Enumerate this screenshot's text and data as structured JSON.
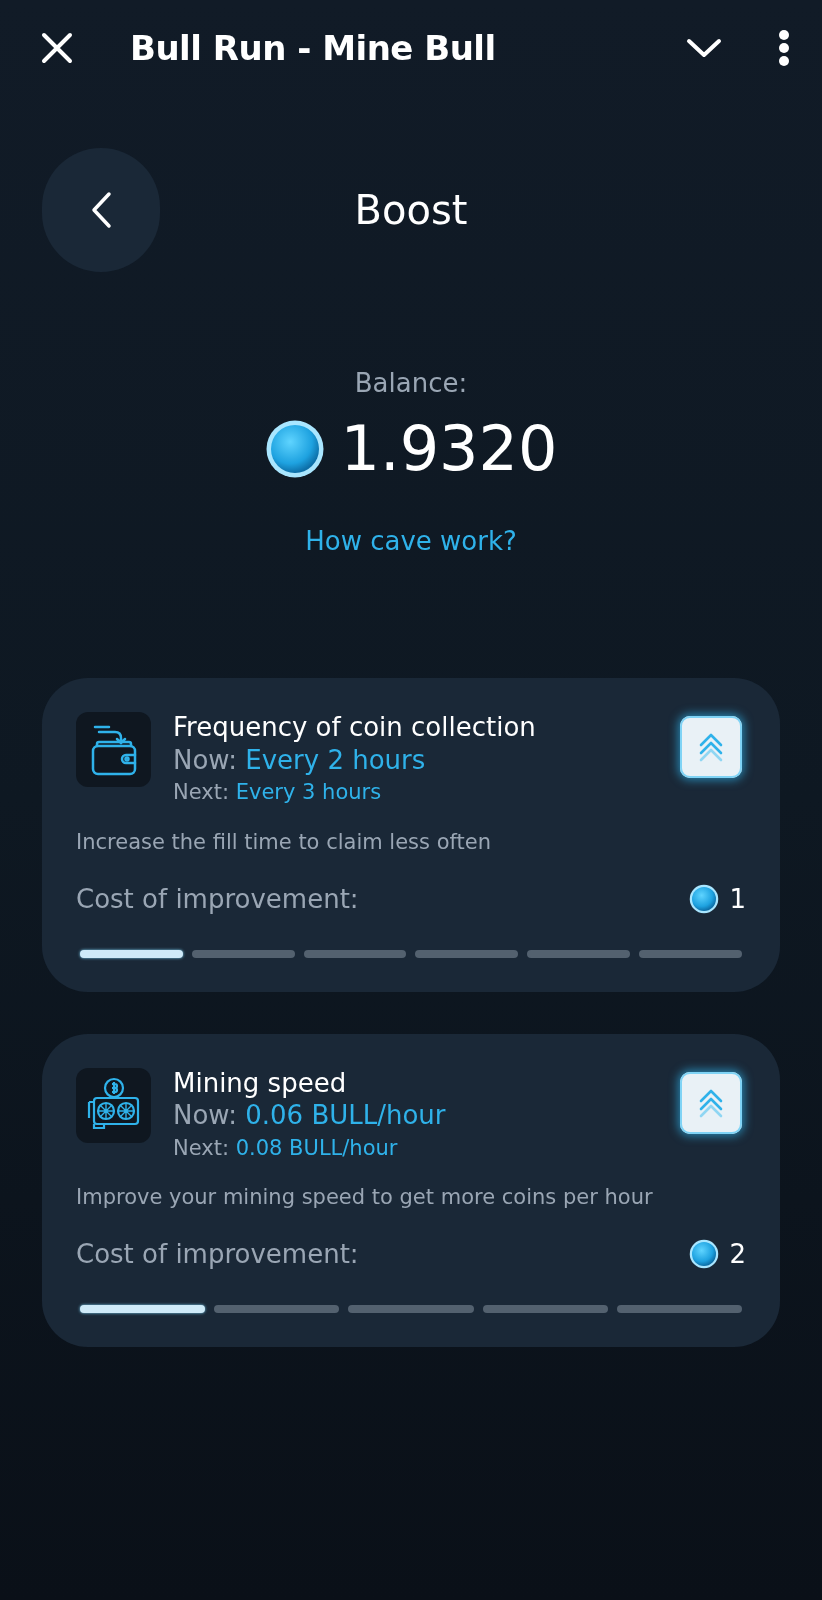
{
  "top_bar": {
    "title": "Bull Run - Mine Bull"
  },
  "header": {
    "title": "Boost"
  },
  "balance": {
    "label": "Balance:",
    "amount": "1.9320",
    "link": "How cave work?"
  },
  "boosts": [
    {
      "kind": "wallet",
      "title": "Frequency of coin collection",
      "now_label": "Now:",
      "now_value": "Every 2 hours",
      "next_label": "Next:",
      "next_value": "Every 3 hours",
      "description": "Increase the fill time to claim less often",
      "cost_label": "Cost of improvement:",
      "cost": "1",
      "segments": [
        {
          "filled": true
        },
        {
          "filled": false
        },
        {
          "filled": false
        },
        {
          "filled": false
        },
        {
          "filled": false
        },
        {
          "filled": false
        }
      ]
    },
    {
      "kind": "gpu",
      "title": "Mining speed",
      "now_label": "Now:",
      "now_value": "0.06 BULL/hour",
      "next_label": "Next:",
      "next_value": "0.08 BULL/hour",
      "description": "Improve your mining speed to get more coins per hour",
      "cost_label": "Cost of improvement:",
      "cost": "2",
      "segments": [
        {
          "filled": true
        },
        {
          "filled": false
        },
        {
          "filled": false
        },
        {
          "filled": false
        },
        {
          "filled": false
        }
      ]
    }
  ]
}
